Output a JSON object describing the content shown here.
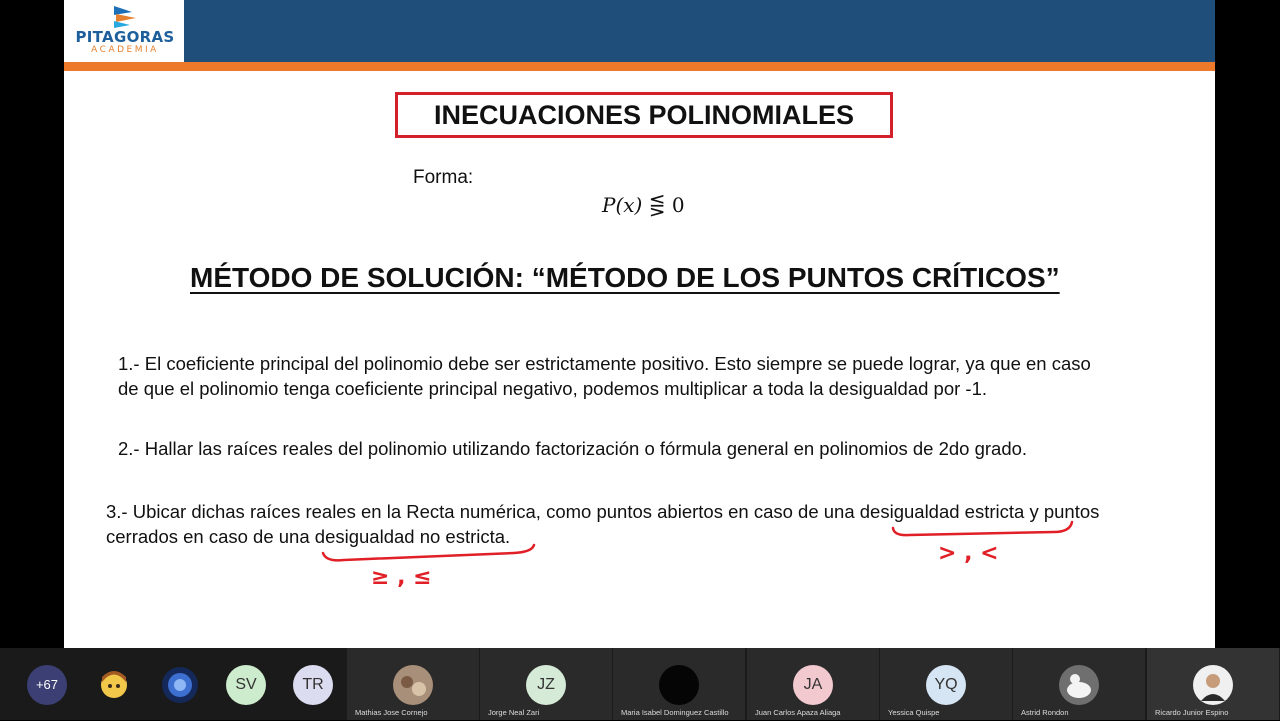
{
  "logo": {
    "name": "PITAGORAS",
    "sub": "ACADEMIA"
  },
  "slide": {
    "title": "INECUACIONES POLINOMIALES",
    "forma_label": "Forma:",
    "formula_lhs": "P(x)",
    "formula_rel": "⋚ 0",
    "method_heading": "MÉTODO DE SOLUCIÓN: “MÉTODO DE LOS PUNTOS CRÍTICOS”",
    "step1_line1": "1.- El coeficiente principal del polinomio debe ser estrictamente positivo. Esto siempre se puede lograr, ya que en caso",
    "step1_line2": "de que el polinomio tenga coeficiente principal negativo, podemos multiplicar a toda la desigualdad por -1.",
    "step2": "2.- Hallar las raíces reales del polinomio utilizando factorización o fórmula general en polinomios de 2do grado.",
    "step3_a": "3.- Ubicar dichas raíces reales en la Recta numérica, como puntos abiertos en caso de una ",
    "step3_b": "desigualdad estricta",
    "step3_c": " y puntos",
    "step3_d": "cerrados en caso de una ",
    "step3_e": "desigualdad no estricta.",
    "annotation_nonstrict": "≥ , ≤",
    "annotation_strict": "> , <"
  },
  "participants": {
    "more_count": "+67",
    "bubbles": [
      {
        "initials": "",
        "color": "#f2c84b"
      },
      {
        "initials": "",
        "color": "#2a5cae"
      },
      {
        "initials": "SV",
        "color": "#cdeccd"
      },
      {
        "initials": "TR",
        "color": "#dcdcf0"
      }
    ],
    "tiles": [
      {
        "name": "Mathias Jose Cornejo",
        "initials": "",
        "color": "#a88f7a"
      },
      {
        "name": "Jorge Neal Zari",
        "initials": "JZ",
        "color": "#d6ead8"
      },
      {
        "name": "Maria Isabel Dominguez Castillo",
        "initials": "",
        "color": "#050505"
      },
      {
        "name": "Juan Carlos Apaza Aliaga",
        "initials": "JA",
        "color": "#f3c9d0"
      },
      {
        "name": "Yessica Quispe",
        "initials": "YQ",
        "color": "#d5e5f3"
      },
      {
        "name": "Astrid Rondon",
        "initials": "",
        "color": "#c9c9c9"
      },
      {
        "name": "Ricardo Junior Espino",
        "initials": "",
        "color": "#f0f0f0"
      }
    ]
  }
}
